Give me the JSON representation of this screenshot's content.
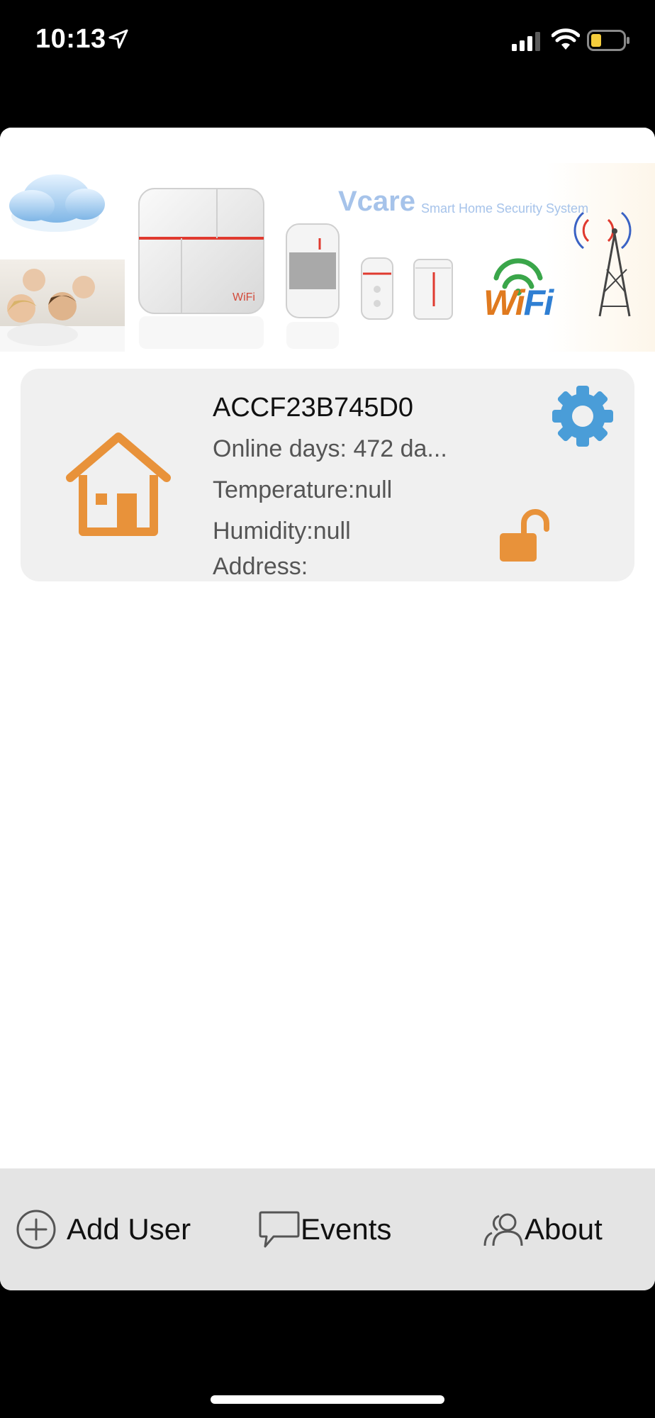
{
  "status_bar": {
    "time": "10:13"
  },
  "banner": {
    "brand": "Vcare",
    "tagline": "Smart Home Security System",
    "wifi_text_wi": "Wi",
    "wifi_text_fi": "Fi",
    "panel_label": "WiFi"
  },
  "device": {
    "id": "ACCF23B745D0",
    "online_days": "Online days: 472 da...",
    "temperature": "Temperature:null",
    "humidity": "Humidity:null",
    "address": "Address:"
  },
  "toolbar": {
    "add_user_label": "Add User",
    "events_label": "Events",
    "about_label": "About"
  },
  "colors": {
    "accent_orange": "#E8923A",
    "gear_blue": "#4A9DD8",
    "card_gray": "#F0F0F0",
    "toolbar_gray": "#E4E4E4"
  },
  "icons": {
    "status": [
      "location-arrow-icon",
      "cellular-signal-icon",
      "wifi-icon",
      "battery-low-icon"
    ],
    "device_card": [
      "house-icon",
      "gear-icon",
      "unlocked-padlock-icon"
    ],
    "toolbar": [
      "plus-circle-icon",
      "speech-bubble-icon",
      "users-icon"
    ]
  }
}
